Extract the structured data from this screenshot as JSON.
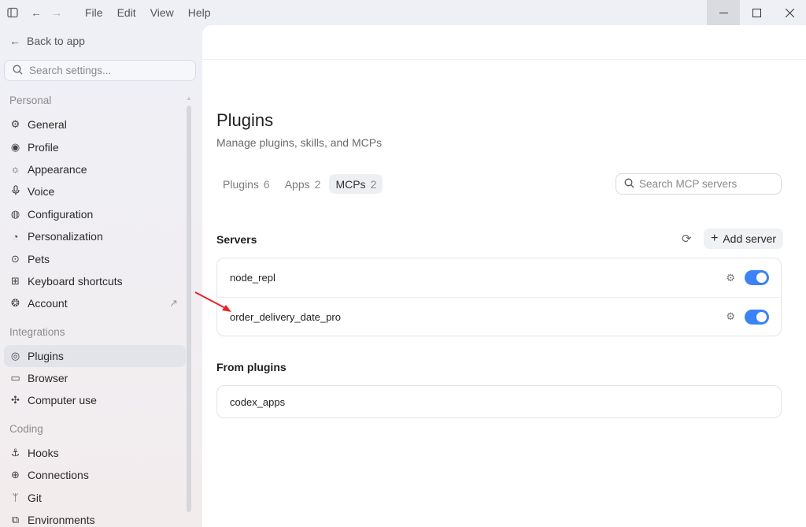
{
  "titlebar": {
    "menus": [
      "File",
      "Edit",
      "View",
      "Help"
    ]
  },
  "sidebar": {
    "back_label": "Back to app",
    "search_placeholder": "Search settings...",
    "sections": [
      {
        "label": "Personal",
        "items": [
          {
            "label": "General",
            "icon": "gear-icon"
          },
          {
            "label": "Profile",
            "icon": "user-circle-icon"
          },
          {
            "label": "Appearance",
            "icon": "sun-icon"
          },
          {
            "label": "Voice",
            "icon": "microphone-icon"
          },
          {
            "label": "Configuration",
            "icon": "sliders-icon"
          },
          {
            "label": "Personalization",
            "icon": "palette-icon"
          },
          {
            "label": "Pets",
            "icon": "pet-icon"
          },
          {
            "label": "Keyboard shortcuts",
            "icon": "keyboard-icon"
          },
          {
            "label": "Account",
            "icon": "account-icon"
          }
        ]
      },
      {
        "label": "Integrations",
        "items": [
          {
            "label": "Plugins",
            "icon": "plugin-icon"
          },
          {
            "label": "Browser",
            "icon": "browser-icon"
          },
          {
            "label": "Computer use",
            "icon": "sparkle-icon"
          }
        ]
      },
      {
        "label": "Coding",
        "items": [
          {
            "label": "Hooks",
            "icon": "anchor-icon"
          },
          {
            "label": "Connections",
            "icon": "globe-icon"
          },
          {
            "label": "Git",
            "icon": "git-branch-icon"
          },
          {
            "label": "Environments",
            "icon": "environment-icon"
          }
        ]
      }
    ]
  },
  "main": {
    "title": "Plugins",
    "subtitle": "Manage plugins, skills, and MCPs",
    "tabs": [
      {
        "label": "Plugins",
        "count": "6"
      },
      {
        "label": "Apps",
        "count": "2"
      },
      {
        "label": "MCPs",
        "count": "2"
      }
    ],
    "active_tab": "MCPs",
    "search_placeholder": "Search MCP servers",
    "servers_heading": "Servers",
    "add_server_label": "Add server",
    "servers": [
      {
        "name": "node_repl",
        "enabled": true
      },
      {
        "name": "order_delivery_date_pro",
        "enabled": true
      }
    ],
    "from_plugins_heading": "From plugins",
    "plugin_servers": [
      {
        "name": "codex_apps"
      }
    ]
  },
  "colors": {
    "accent": "#3b82f6",
    "annotation_arrow": "#e5262a"
  }
}
